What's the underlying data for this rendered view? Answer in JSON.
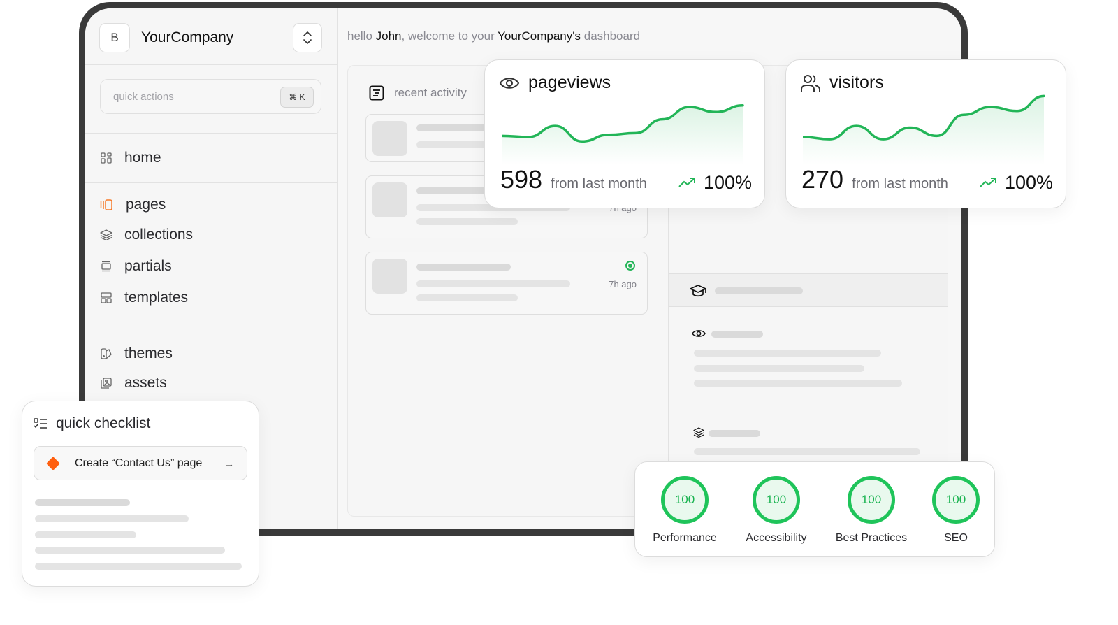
{
  "brand": {
    "badge": "B",
    "name": "YourCompany"
  },
  "search": {
    "placeholder": "quick actions",
    "shortcut": "⌘ K"
  },
  "sidebar": {
    "items": [
      {
        "label": "home",
        "icon": "grid-icon",
        "active": false
      },
      {
        "label": "pages",
        "icon": "pages-icon",
        "active": true
      },
      {
        "label": "collections",
        "icon": "layers-icon",
        "active": false
      },
      {
        "label": "partials",
        "icon": "partials-icon",
        "active": false
      },
      {
        "label": "templates",
        "icon": "templates-icon",
        "active": false
      },
      {
        "label": "themes",
        "icon": "themes-icon",
        "active": false
      },
      {
        "label": "assets",
        "icon": "assets-icon",
        "active": false
      }
    ]
  },
  "greeting": {
    "prefix": "hello ",
    "user": "John",
    "middle": ", welcome to your ",
    "company": "YourCompany's",
    "suffix": " dashboard"
  },
  "activity": {
    "title": "recent activity",
    "items": [
      {
        "time": ""
      },
      {
        "time": "7h ago"
      },
      {
        "time": "7h ago",
        "live": true
      }
    ]
  },
  "stats": [
    {
      "title": "pageviews",
      "icon": "eye-icon",
      "value": "598",
      "sub": "from last month",
      "change": "100%",
      "trend": [
        40,
        38,
        58,
        30,
        42,
        45,
        70,
        92,
        83,
        95
      ]
    },
    {
      "title": "visitors",
      "icon": "users-icon",
      "value": "270",
      "sub": "from last month",
      "change": "100%",
      "trend": [
        38,
        34,
        58,
        34,
        55,
        40,
        78,
        92,
        85,
        112
      ]
    }
  ],
  "checklist": {
    "title": "quick checklist",
    "task": "Create “Contact Us” page"
  },
  "scores": [
    {
      "value": "100",
      "label": "Performance"
    },
    {
      "value": "100",
      "label": "Accessibility"
    },
    {
      "value": "100",
      "label": "Best Practices"
    },
    {
      "value": "100",
      "label": "SEO"
    }
  ],
  "colors": {
    "accent_green": "#22b557",
    "accent_orange": "#ff5f0f"
  }
}
